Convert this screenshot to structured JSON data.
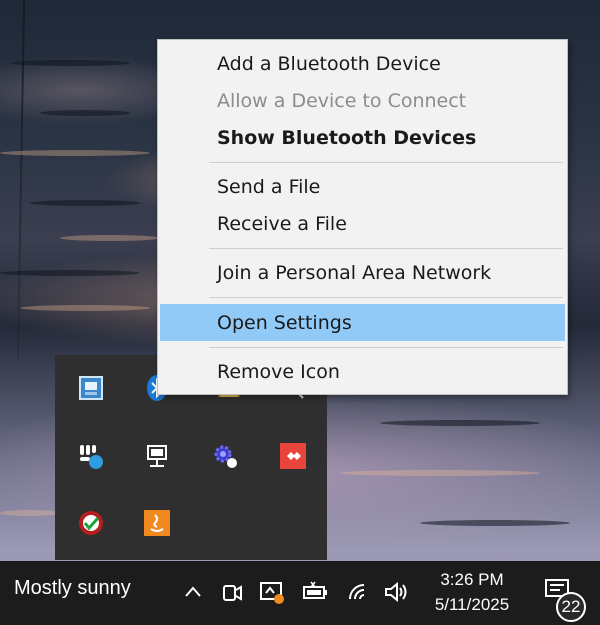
{
  "context_menu": {
    "items": [
      {
        "label": "Add a Bluetooth Device",
        "state": "normal"
      },
      {
        "label": "Allow a Device to Connect",
        "state": "disabled"
      },
      {
        "label": "Show Bluetooth Devices",
        "state": "bold"
      },
      {
        "label": "Send a File",
        "state": "normal"
      },
      {
        "label": "Receive a File",
        "state": "normal"
      },
      {
        "label": "Join a Personal Area Network",
        "state": "normal"
      },
      {
        "label": "Open Settings",
        "state": "highlighted"
      },
      {
        "label": "Remove Icon",
        "state": "normal"
      }
    ],
    "highlight_color": "#91c9f7"
  },
  "tray_flyout": {
    "icons": [
      "display-app-icon",
      "bluetooth-icon",
      "warning-app-icon",
      "search-app-icon",
      "slack-icon",
      "network-monitor-icon",
      "gear-app-icon",
      "anydesk-icon",
      "security-shield-icon",
      "java-icon"
    ]
  },
  "taskbar": {
    "weather": "Mostly sunny",
    "time": "3:26 PM",
    "date": "5/11/2025",
    "notification_count": "22",
    "icons": [
      "chevron-up-icon",
      "camera-icon",
      "screen-capture-icon",
      "battery-icon",
      "wifi-icon",
      "volume-icon",
      "notification-icon"
    ]
  }
}
